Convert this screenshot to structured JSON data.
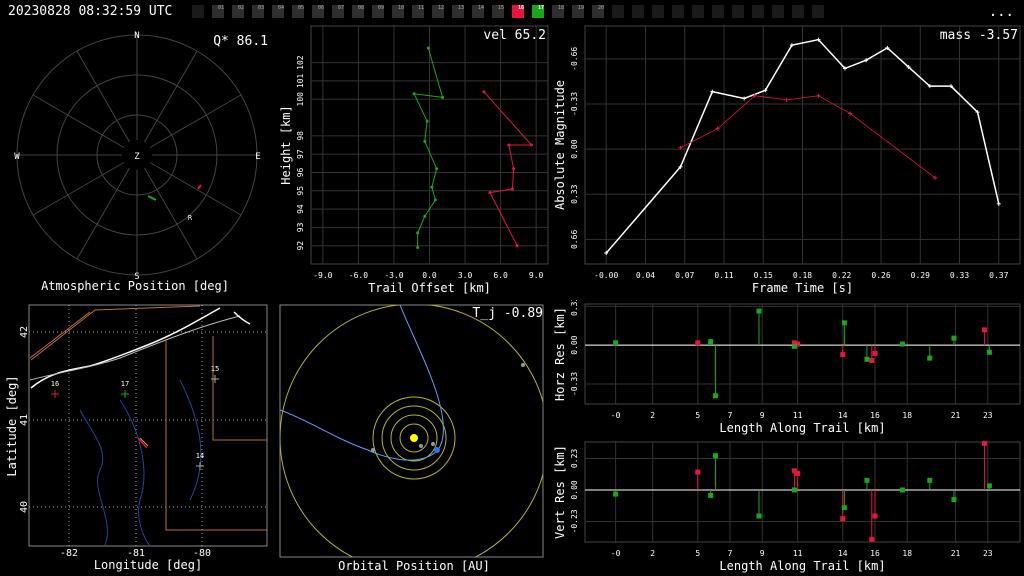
{
  "header": {
    "timestamp": "20230828 08:32:59 UTC",
    "more_label": "...",
    "stations": [
      {
        "id": "",
        "state": "dim"
      },
      {
        "id": "01",
        "state": "off"
      },
      {
        "id": "02",
        "state": "off"
      },
      {
        "id": "03",
        "state": "off"
      },
      {
        "id": "04",
        "state": "off"
      },
      {
        "id": "05",
        "state": "off"
      },
      {
        "id": "06",
        "state": "off"
      },
      {
        "id": "07",
        "state": "off"
      },
      {
        "id": "08",
        "state": "off"
      },
      {
        "id": "09",
        "state": "off"
      },
      {
        "id": "10",
        "state": "off"
      },
      {
        "id": "11",
        "state": "off"
      },
      {
        "id": "12",
        "state": "off"
      },
      {
        "id": "13",
        "state": "off"
      },
      {
        "id": "14",
        "state": "off"
      },
      {
        "id": "15",
        "state": "off"
      },
      {
        "id": "16",
        "state": "red"
      },
      {
        "id": "17",
        "state": "green"
      },
      {
        "id": "18",
        "state": "off"
      },
      {
        "id": "19",
        "state": "off"
      },
      {
        "id": "20",
        "state": "off"
      },
      {
        "id": "",
        "state": "dim"
      },
      {
        "id": "",
        "state": "dim"
      },
      {
        "id": "",
        "state": "dim"
      },
      {
        "id": "",
        "state": "dim"
      },
      {
        "id": "",
        "state": "dim"
      },
      {
        "id": "",
        "state": "dim"
      },
      {
        "id": "",
        "state": "dim"
      },
      {
        "id": "",
        "state": "dim"
      },
      {
        "id": "",
        "state": "dim"
      },
      {
        "id": "",
        "state": "dim"
      },
      {
        "id": "",
        "state": "dim"
      }
    ],
    "colors": {
      "red": "#e8163c",
      "green": "#1aa81a",
      "off": "#2f2f2f",
      "dim": "#1a1a1a"
    }
  },
  "atmospheric": {
    "title": "Atmospheric Position [deg]",
    "readout": "Q* 86.1",
    "compass": {
      "n": "N",
      "s": "S",
      "e": "E",
      "w": "W",
      "z": "Z"
    },
    "radiant_label": "R"
  },
  "trail": {
    "readout": "vel 65.2",
    "chart_data": {
      "type": "scatter",
      "xlabel": "Trail Offset [km]",
      "ylabel": "Height [km]",
      "xlim": [
        -10,
        10
      ],
      "ylim": [
        91,
        104
      ],
      "x_ticks": [
        "-9.0",
        "-6.0",
        "-3.0",
        "0.0",
        "3.0",
        "6.0",
        "9.0"
      ],
      "y_ticks": [
        "92",
        "93",
        "94",
        "95",
        "96",
        "97",
        "98",
        "100",
        "101",
        "102"
      ],
      "series": [
        {
          "color": "#e8163c",
          "x": [
            4.6,
            8.6,
            6.7,
            7.1,
            7.0,
            5.1,
            7.4
          ],
          "y": [
            100.4,
            97.5,
            97.5,
            96.2,
            95.1,
            94.9,
            92.0
          ]
        },
        {
          "color": "#1aa81a",
          "x": [
            -0.1,
            1.1,
            -1.3,
            -0.2,
            -0.4,
            0.6,
            0.2,
            0.5,
            -0.4,
            -1.0,
            -1.0
          ],
          "y": [
            102.8,
            100.1,
            100.3,
            98.8,
            97.7,
            96.2,
            95.2,
            94.5,
            93.6,
            92.7,
            91.9
          ]
        }
      ]
    }
  },
  "lightcurve": {
    "readout": "mass -3.57",
    "chart_data": {
      "type": "line",
      "xlabel": "Frame Time [s]",
      "ylabel": "Absolute Magnitude",
      "xlim": [
        -0.02,
        0.39
      ],
      "ylim": [
        0.84,
        -0.9
      ],
      "x_ticks": [
        "-0.00",
        "0.04",
        "0.07",
        "0.11",
        "0.15",
        "0.18",
        "0.22",
        "0.26",
        "0.29",
        "0.33",
        "0.37"
      ],
      "y_ticks": [
        "-0.66",
        "-0.33",
        "0.00",
        "0.33",
        "0.66"
      ],
      "series": [
        {
          "color": "#ffffff",
          "x": [
            0.0,
            0.07,
            0.1,
            0.13,
            0.15,
            0.175,
            0.2,
            0.225,
            0.245,
            0.265,
            0.285,
            0.305,
            0.325,
            0.35,
            0.37
          ],
          "y": [
            0.76,
            0.13,
            -0.42,
            -0.37,
            -0.43,
            -0.76,
            -0.8,
            -0.59,
            -0.65,
            -0.74,
            -0.6,
            -0.46,
            -0.46,
            -0.27,
            0.4
          ]
        },
        {
          "color": "#e8163c",
          "x": [
            0.07,
            0.105,
            0.14,
            0.17,
            0.2,
            0.23,
            0.31
          ],
          "y": [
            -0.01,
            -0.15,
            -0.39,
            -0.36,
            -0.39,
            -0.26,
            0.21
          ]
        }
      ]
    }
  },
  "map": {
    "xlabel": "Longitude [deg]",
    "ylabel": "Latitude [deg]",
    "x_ticks": [
      "-82",
      "-81",
      "-80"
    ],
    "y_ticks": [
      "42",
      "41",
      "40"
    ],
    "stations": [
      {
        "id": "16",
        "color": "#e8163c"
      },
      {
        "id": "17",
        "color": "#1aa81a"
      },
      {
        "id": "15",
        "color": "#aaaaaa"
      },
      {
        "id": "14",
        "color": "#aaaaaa"
      }
    ]
  },
  "orbit": {
    "title": "Orbital Position [AU]",
    "readout": "T_j -0.89"
  },
  "horz_res": {
    "chart_data": {
      "type": "scatter",
      "xlabel": "Length Along Trail [km]",
      "ylabel": "Horz Res [km]",
      "xlim": [
        -2,
        25
      ],
      "ylim": [
        -0.5,
        0.35
      ],
      "x_ticks": [
        "-0",
        "2",
        "5",
        "7",
        "9",
        "11",
        "14",
        "16",
        "18",
        "21",
        "23"
      ],
      "y_ticks": [
        "0.33",
        "0.00",
        "-0.33"
      ],
      "series": [
        {
          "color": "#e8163c",
          "x": [
            5.0,
            11.0,
            11.2,
            14.0,
            15.8,
            16.0,
            22.8
          ],
          "y": [
            0.02,
            0.02,
            0.01,
            -0.08,
            -0.13,
            -0.07,
            0.13
          ]
        },
        {
          "color": "#1aa81a",
          "x": [
            -0.1,
            5.8,
            6.1,
            8.8,
            11.0,
            14.1,
            15.5,
            17.7,
            19.4,
            20.9,
            23.1
          ],
          "y": [
            0.02,
            0.03,
            -0.43,
            0.29,
            -0.01,
            0.19,
            -0.12,
            0.01,
            -0.11,
            0.06,
            -0.06
          ]
        }
      ]
    }
  },
  "vert_res": {
    "chart_data": {
      "type": "scatter",
      "xlabel": "Length Along Trail [km]",
      "ylabel": "Vert Res [km]",
      "xlim": [
        -2,
        25
      ],
      "ylim": [
        -0.38,
        0.35
      ],
      "x_ticks": [
        "-0",
        "2",
        "5",
        "7",
        "9",
        "11",
        "14",
        "16",
        "18",
        "21",
        "23"
      ],
      "y_ticks": [
        "0.23",
        "0.00",
        "-0.23"
      ],
      "series": [
        {
          "color": "#e8163c",
          "x": [
            5.0,
            11.0,
            11.2,
            14.0,
            15.8,
            16.0,
            22.8
          ],
          "y": [
            0.13,
            0.14,
            0.12,
            -0.21,
            -0.36,
            -0.19,
            0.34
          ]
        },
        {
          "color": "#1aa81a",
          "x": [
            -0.1,
            5.8,
            6.1,
            8.8,
            11.0,
            14.1,
            15.5,
            17.7,
            19.4,
            20.9,
            23.1
          ],
          "y": [
            -0.03,
            -0.04,
            0.25,
            -0.19,
            0.0,
            -0.13,
            0.07,
            0.0,
            0.07,
            -0.07,
            0.03
          ]
        }
      ]
    }
  }
}
